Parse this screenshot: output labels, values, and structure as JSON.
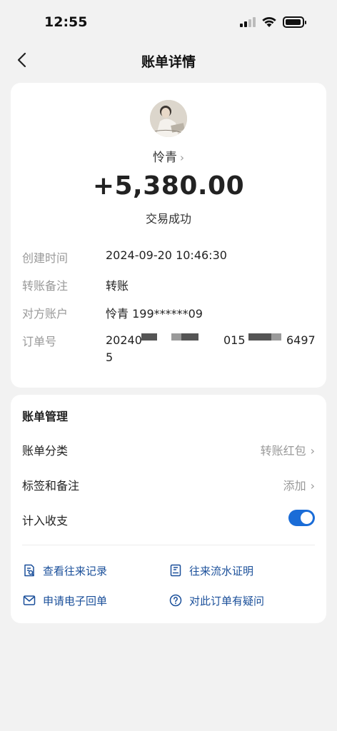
{
  "status_bar": {
    "time": "12:55"
  },
  "nav": {
    "title": "账单详情"
  },
  "transaction": {
    "payee": "怜青",
    "amount": "+5,380.00",
    "status": "交易成功"
  },
  "details": [
    {
      "label": "创建时间",
      "value": "2024-09-20 10:46:30"
    },
    {
      "label": "转账备注",
      "value": "转账"
    },
    {
      "label": "对方账户",
      "value": "怜青 199******09"
    },
    {
      "label": "订单号",
      "value": "20240                          015                6497\n5"
    }
  ],
  "order_parts": {
    "a": "20240",
    "b": "015",
    "c": "6497",
    "d": "5"
  },
  "management": {
    "title": "账单管理",
    "category_label": "账单分类",
    "category_value": "转账红包",
    "tags_label": "标签和备注",
    "tags_value": "添加",
    "count_label": "计入收支",
    "count_enabled": true
  },
  "actions": {
    "history": "查看往来记录",
    "statement": "往来流水证明",
    "receipt": "申请电子回单",
    "question": "对此订单有疑问"
  },
  "colors": {
    "accent": "#1a6cd7",
    "link": "#1a4f9a",
    "background": "#f2f2f2"
  }
}
